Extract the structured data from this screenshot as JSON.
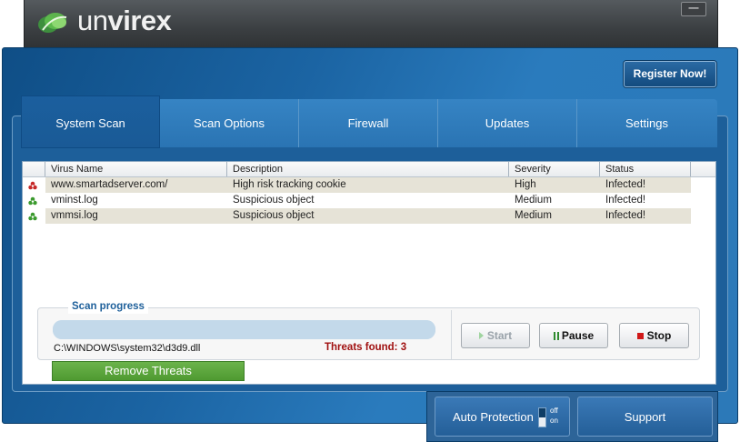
{
  "app": {
    "logo_prefix": "un",
    "logo_name": "virex"
  },
  "window": {
    "minimize_label": "—"
  },
  "register_label": "Register Now!",
  "tabs": [
    {
      "label": "System Scan",
      "active": true
    },
    {
      "label": "Scan Options",
      "active": false
    },
    {
      "label": "Firewall",
      "active": false
    },
    {
      "label": "Updates",
      "active": false
    },
    {
      "label": "Settings",
      "active": false
    }
  ],
  "threats_table": {
    "columns": [
      "Virus Name",
      "Description",
      "Severity",
      "Status"
    ],
    "rows": [
      {
        "icon": "biohazard-red-icon",
        "name": "www.smartadserver.com/",
        "description": "High risk tracking cookie",
        "severity": "High",
        "status": "Infected!"
      },
      {
        "icon": "biohazard-green-icon",
        "name": "vminst.log",
        "description": "Suspicious object",
        "severity": "Medium",
        "status": "Infected!"
      },
      {
        "icon": "biohazard-green-icon",
        "name": "vmmsi.log",
        "description": "Suspicious object",
        "severity": "Medium",
        "status": "Infected!"
      }
    ]
  },
  "scan": {
    "legend": "Scan progress",
    "current_file": "C:\\WINDOWS\\system32\\d3d9.dll",
    "threats_found": "Threats found: 3",
    "start_label": "Start",
    "pause_label": "Pause",
    "stop_label": "Stop"
  },
  "remove_label": "Remove Threats",
  "dock": {
    "auto_protection_label": "Auto Protection",
    "toggle_off": "off",
    "toggle_on": "on",
    "support_label": "Support"
  },
  "colors": {
    "frame_blue": "#1b64a3",
    "remove_green": "#5aa83c",
    "threat_red": "#a01010"
  }
}
